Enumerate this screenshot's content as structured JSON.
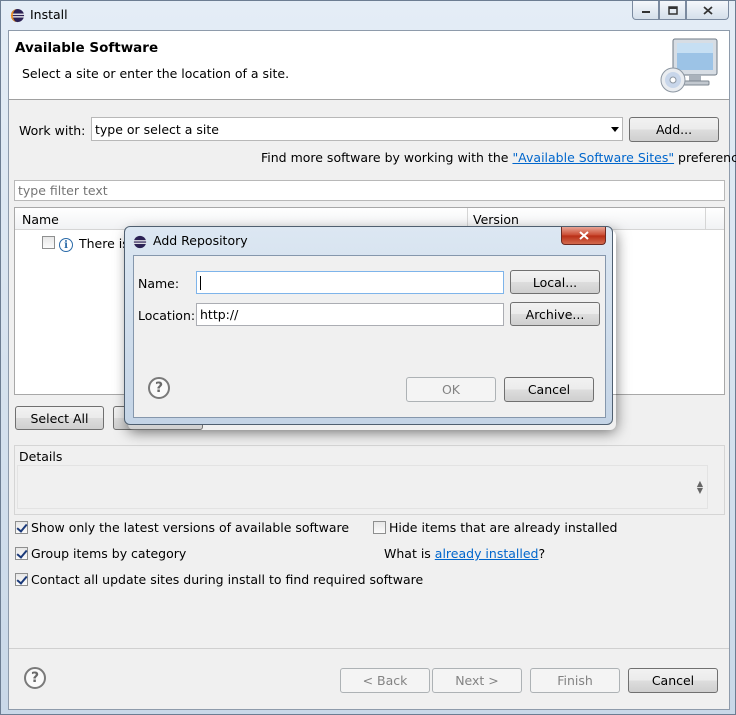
{
  "window": {
    "title": "Install",
    "icon": "eclipse-icon"
  },
  "banner": {
    "title": "Available Software",
    "description": "Select a site or enter the location of a site.",
    "icon": "install-cd-monitor-icon"
  },
  "work_with": {
    "label": "Work with:",
    "value": "type or select a site",
    "add_button": "Add...",
    "find_more_prefix": "Find more software by working with the ",
    "find_more_link": "\"Available Software Sites\"",
    "find_more_suffix": " preferences."
  },
  "filter": {
    "placeholder": "type filter text"
  },
  "tree": {
    "columns": [
      "Name",
      "Version"
    ],
    "row_text": "There is"
  },
  "buttons": {
    "select_all": "Select All"
  },
  "details": {
    "label": "Details"
  },
  "options": {
    "show_latest": {
      "label": "Show only the latest versions of available software",
      "checked": true
    },
    "group_by_category": {
      "label": "Group items by category",
      "checked": true
    },
    "contact_sites": {
      "label": "Contact all update sites during install to find required software",
      "checked": true
    },
    "hide_installed": {
      "label": "Hide items that are already installed",
      "checked": false
    },
    "what_is_prefix": "What is ",
    "what_is_link": "already installed",
    "what_is_suffix": "?"
  },
  "footer": {
    "back": "< Back",
    "next": "Next >",
    "finish": "Finish",
    "cancel": "Cancel"
  },
  "dialog": {
    "title": "Add Repository",
    "close": "x",
    "name_label": "Name:",
    "name_value": "",
    "location_label": "Location:",
    "location_value": "http://",
    "local_button": "Local...",
    "archive_button": "Archive...",
    "ok_button": "OK",
    "cancel_button": "Cancel"
  },
  "help_icon": "?"
}
